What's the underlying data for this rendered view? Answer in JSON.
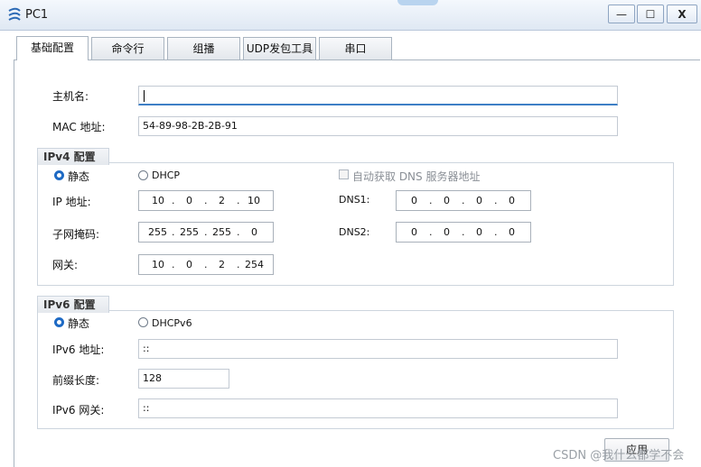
{
  "window": {
    "title": "PC1",
    "minimize": "—",
    "maximize": "☐",
    "close": "X"
  },
  "tabs": [
    "基础配置",
    "命令行",
    "组播",
    "UDP发包工具",
    "串口"
  ],
  "basic": {
    "hostname_label": "主机名:",
    "hostname_value": "",
    "mac_label": "MAC 地址:",
    "mac_value": "54-89-98-2B-2B-91"
  },
  "ipv4": {
    "group_title": "IPv4 配置",
    "static_label": "静态",
    "dhcp_label": "DHCP",
    "auto_dns_label": "自动获取 DNS 服务器地址",
    "ip_label": "IP 地址:",
    "ip": [
      "10",
      "0",
      "2",
      "10"
    ],
    "mask_label": "子网掩码:",
    "mask": [
      "255",
      "255",
      "255",
      "0"
    ],
    "gateway_label": "网关:",
    "gateway": [
      "10",
      "0",
      "2",
      "254"
    ],
    "dns1_label": "DNS1:",
    "dns1": [
      "0",
      "0",
      "0",
      "0"
    ],
    "dns2_label": "DNS2:",
    "dns2": [
      "0",
      "0",
      "0",
      "0"
    ],
    "mode": "static"
  },
  "ipv6": {
    "group_title": "IPv6 配置",
    "static_label": "静态",
    "dhcp_label": "DHCPv6",
    "ip_label": "IPv6 地址:",
    "ip_value": "::",
    "prefix_label": "前缀长度:",
    "prefix_value": "128",
    "gateway_label": "IPv6 网关:",
    "gateway_value": "::",
    "mode": "static"
  },
  "apply_button": "应用",
  "watermark": "CSDN @我什么都学不会",
  "colors": {
    "accent": "#1e6ac4",
    "focus_underline": "#3d7fc6"
  }
}
